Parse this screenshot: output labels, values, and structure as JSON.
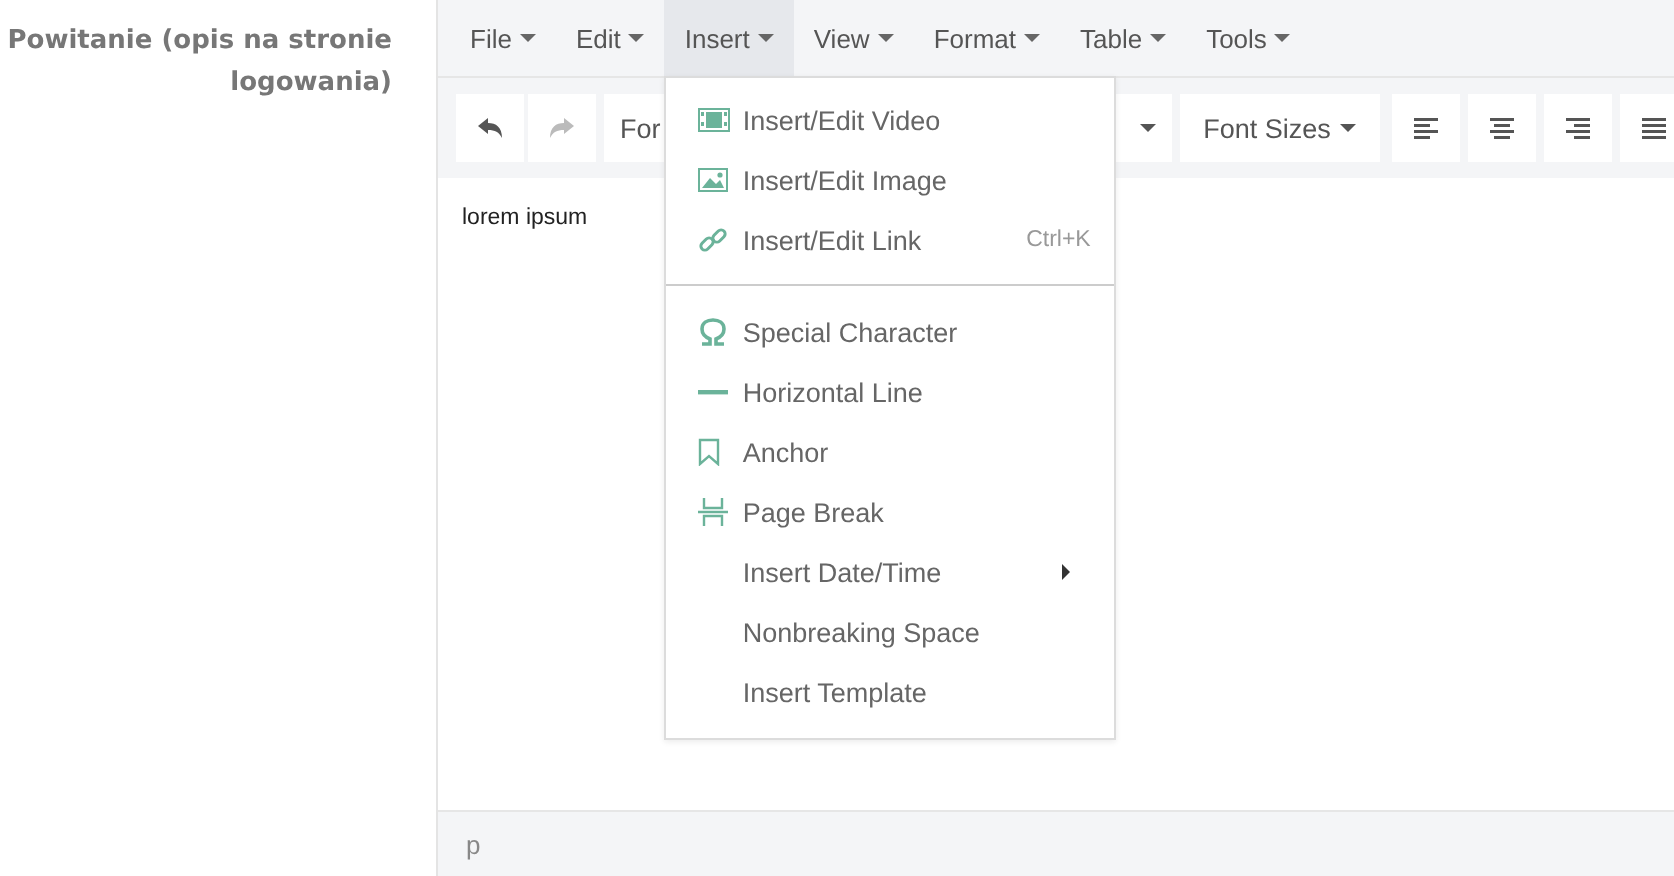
{
  "field_label": "Powitanie (opis na stronie logowania)",
  "menubar": [
    {
      "label": "File",
      "selected": false
    },
    {
      "label": "Edit",
      "selected": false
    },
    {
      "label": "Insert",
      "selected": true
    },
    {
      "label": "View",
      "selected": false
    },
    {
      "label": "Format",
      "selected": false
    },
    {
      "label": "Table",
      "selected": false
    },
    {
      "label": "Tools",
      "selected": false
    }
  ],
  "insert_menu": [
    [
      {
        "kind": "video",
        "label": "Insert/Edit Video"
      },
      {
        "kind": "image",
        "label": "Insert/Edit Image"
      },
      {
        "kind": "link",
        "label": "Insert/Edit Link",
        "shortcut": "Ctrl+K"
      }
    ],
    [
      {
        "kind": "omega",
        "label": "Special Character"
      },
      {
        "kind": "hr",
        "label": "Horizontal Line"
      },
      {
        "kind": "anchor",
        "label": "Anchor"
      },
      {
        "kind": "pagebreak",
        "label": "Page Break"
      },
      {
        "kind": "plain",
        "label": "Insert Date/Time",
        "submenu": true
      },
      {
        "kind": "plain",
        "label": "Nonbreaking Space"
      },
      {
        "kind": "plain",
        "label": "Insert Template"
      }
    ]
  ],
  "toolbar": {
    "formats": "For",
    "font_sizes": "Font Sizes"
  },
  "content": "lorem ipsum",
  "status_bar": {
    "path": "p"
  }
}
